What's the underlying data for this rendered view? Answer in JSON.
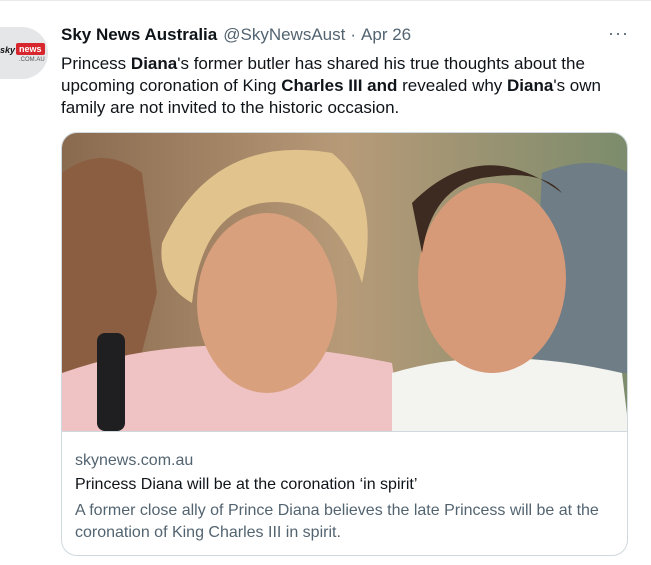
{
  "tweet": {
    "avatar_sky": "sky",
    "avatar_news": "news",
    "avatar_comau": ".COM.AU",
    "name": "Sky News Australia",
    "handle": "@SkyNewsAust",
    "separator": "·",
    "date": "Apr 26",
    "more": "···",
    "text_parts": {
      "p1": "Princess ",
      "b1": "Diana",
      "p2": "'s former butler has shared his true thoughts about the upcoming coronation of King ",
      "b2": "Charles III and",
      "p3": " revealed why ",
      "b3": "Diana",
      "p4": "'s own family are not invited to the historic occasion."
    }
  },
  "card": {
    "domain": "skynews.com.au",
    "title": "Princess Diana will be at the coronation ‘in spirit’",
    "description": "A former close ally of Prince Diana believes the late Princess will be at the coronation of King Charles III in spirit."
  },
  "colors": {
    "text": "#0f1419",
    "secondary": "#536471",
    "border": "#cfd9de",
    "brand_red": "#d7262d"
  }
}
